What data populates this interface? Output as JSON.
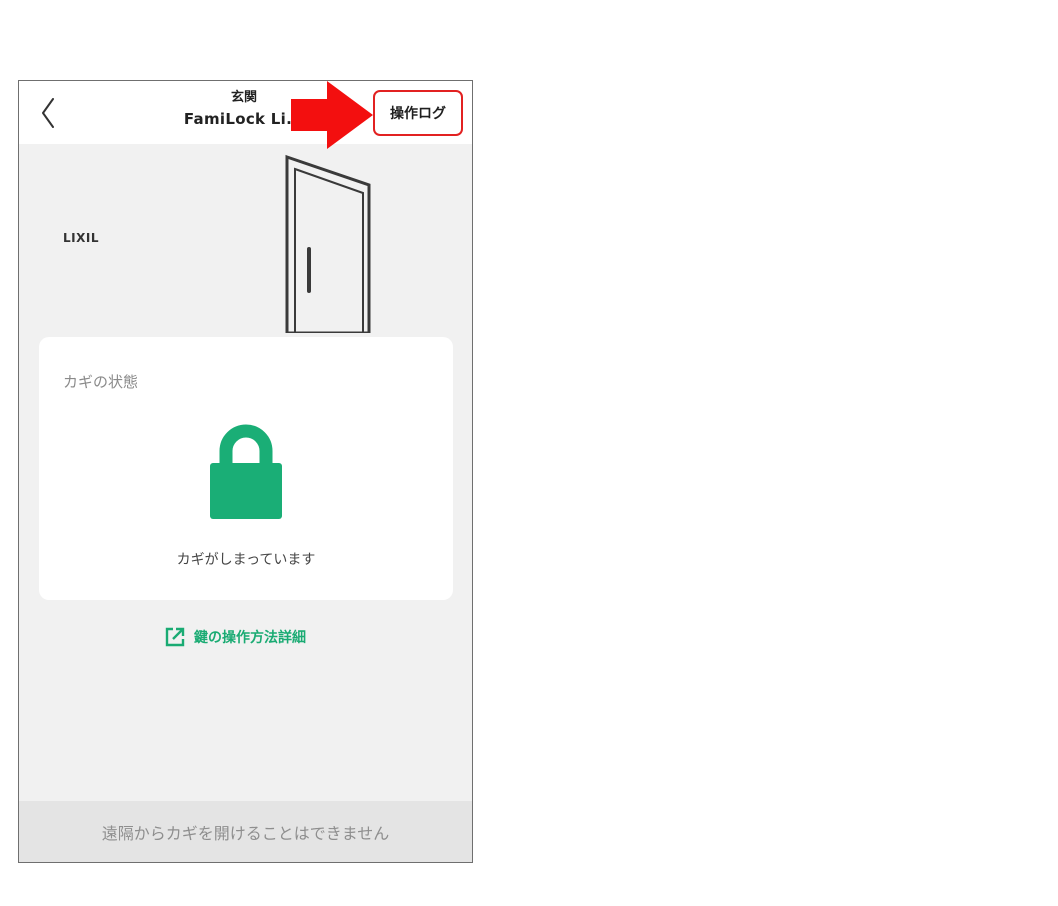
{
  "header": {
    "title_line1": "玄関",
    "title_line2": "FamiLock Li...",
    "oplog_label": "操作ログ"
  },
  "door_panel": {
    "brand_label": "LIXIL"
  },
  "status_card": {
    "heading": "カギの状態",
    "lock_state": "locked",
    "status_text": "カギがしまっています"
  },
  "help_link": {
    "label": "鍵の操作方法詳細"
  },
  "footer": {
    "notice": "遠隔からカギを開けることはできません"
  },
  "colors": {
    "accent_green": "#1aab73",
    "lock_green": "#1aae76",
    "highlight_red": "#e22121",
    "arrow_red": "#f30f0f",
    "background": "#f1f1f1"
  },
  "icons": {
    "back": "chevron-left-icon",
    "lock": "padlock-icon",
    "help": "external-link-icon",
    "arrow": "red-arrow-icon",
    "door": "door-icon"
  }
}
